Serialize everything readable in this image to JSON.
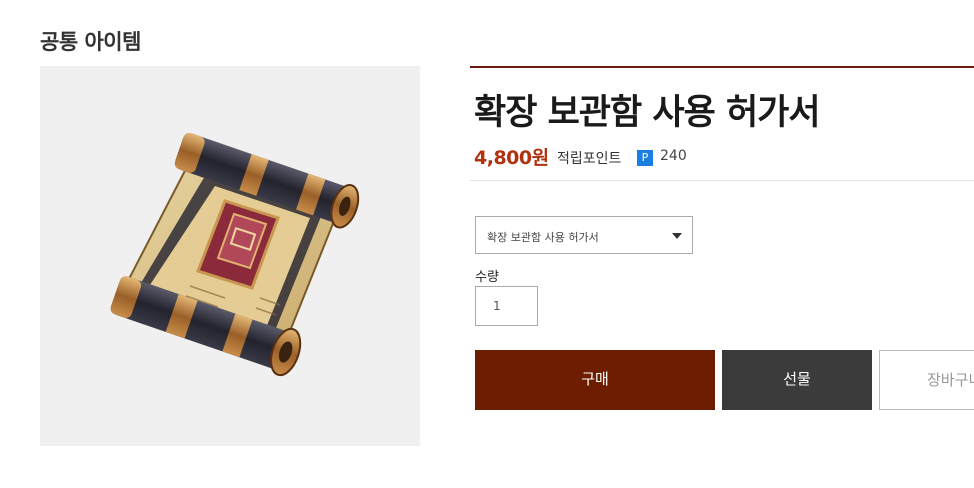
{
  "category": "공통 아이템",
  "product": {
    "image_alt": "scroll-illustration",
    "title": "확장 보관함 사용 허가서",
    "price": "4,800원",
    "points_label": "적립포인트",
    "points_icon_text": "P",
    "points_value": "240"
  },
  "option_select": {
    "selected": "확장 보관함 사용 허가서"
  },
  "quantity": {
    "label": "수량",
    "value": "1"
  },
  "buttons": {
    "buy": "구매",
    "gift": "선물",
    "cart": "장바구니"
  },
  "colors": {
    "accent": "#6d1e00",
    "price": "#b0320f",
    "points_icon": "#1a7fe0",
    "gift_button": "#3b3b3b",
    "image_bg": "#f0f0f0"
  }
}
